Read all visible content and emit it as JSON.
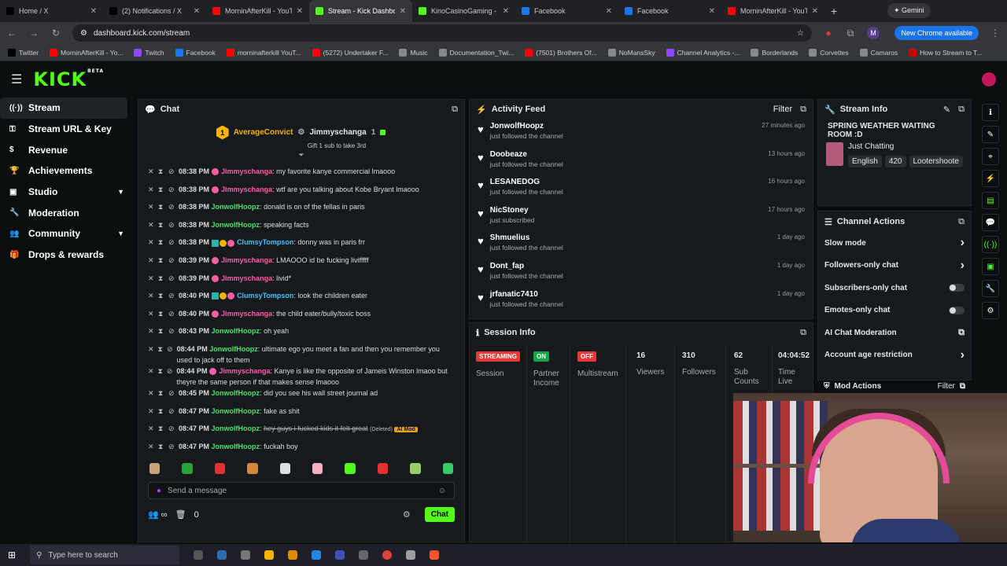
{
  "browser": {
    "tabs": [
      {
        "label": "Home / X",
        "color": "#000000"
      },
      {
        "label": "(2) Notifications / X",
        "color": "#000000"
      },
      {
        "label": "MorninAfterKill - YouTu",
        "color": "#ff0000"
      },
      {
        "label": "Stream - Kick Dashboard",
        "color": "#53fc18"
      },
      {
        "label": "KinoCasinoGaming - W",
        "color": "#53fc18"
      },
      {
        "label": "Facebook",
        "color": "#1877f2"
      },
      {
        "label": "Facebook",
        "color": "#1877f2"
      },
      {
        "label": "MorninAfterKill - YouTu",
        "color": "#ff0000"
      }
    ],
    "gemini_label": "Gemini",
    "url": "dashboard.kick.com/stream",
    "new_chrome": "New Chrome available",
    "profile_initial": "M",
    "bookmarks": [
      "Twitter",
      "MorninAfterKill - Yo...",
      "Twitch",
      "Facebook",
      "morninafterkill YouT...",
      "(5272) Undertaker F...",
      "Music",
      "Documentation_Twi...",
      "(7501) Brothers Of...",
      "NoMansSky",
      "Channel Analytics -...",
      "Borderlands",
      "Corvettes",
      "Camaros",
      "How to Stream to T..."
    ]
  },
  "kick": {
    "logo": "KICK",
    "beta": "BETA"
  },
  "sidebar": {
    "items": [
      {
        "label": "Stream",
        "icon": "stream-icon"
      },
      {
        "label": "Stream URL & Key",
        "icon": "key-icon"
      },
      {
        "label": "Revenue",
        "icon": "dollar-icon"
      },
      {
        "label": "Achievements",
        "icon": "trophy-icon"
      },
      {
        "label": "Studio",
        "icon": "studio-icon"
      },
      {
        "label": "Moderation",
        "icon": "wrench-icon"
      },
      {
        "label": "Community",
        "icon": "people-icon"
      },
      {
        "label": "Drops & rewards",
        "icon": "gift-icon"
      }
    ]
  },
  "chat": {
    "title": "Chat",
    "pinned": {
      "gifter": "AverageConvict",
      "gifter_count": "1",
      "recipient": "Jimmyschanga",
      "recipient_count": "1",
      "note": "Gift 1 sub to take 3rd"
    },
    "messages": [
      {
        "time": "08:38 PM",
        "user": "Jimmyschanga",
        "color": "pink",
        "text": "my favorite kanye commercial lmaooo"
      },
      {
        "time": "08:38 PM",
        "user": "Jimmyschanga",
        "color": "pink",
        "text": "wtf are you talking about Kobe Bryant lmaooo"
      },
      {
        "time": "08:38 PM",
        "user": "JonwolfHoopz",
        "color": "green",
        "text": "donald is on of the fellas in paris"
      },
      {
        "time": "08:38 PM",
        "user": "JonwolfHoopz",
        "color": "green",
        "text": "speaking facts"
      },
      {
        "time": "08:38 PM",
        "user": "ClumsyTompson",
        "color": "blue",
        "text": "donny was in paris frr"
      },
      {
        "time": "08:39 PM",
        "user": "Jimmyschanga",
        "color": "pink",
        "text": "LMAOOO id be fucking livifffff"
      },
      {
        "time": "08:39 PM",
        "user": "Jimmyschanga",
        "color": "pink",
        "text": "livid*"
      },
      {
        "time": "08:40 PM",
        "user": "ClumsyTompson",
        "color": "blue",
        "text": "look the children eater"
      },
      {
        "time": "08:40 PM",
        "user": "Jimmyschanga",
        "color": "pink",
        "text": "the child eater/bully/toxic boss"
      },
      {
        "time": "08:43 PM",
        "user": "JonwolfHoopz",
        "color": "green",
        "text": "oh yeah"
      },
      {
        "time": "08:44 PM",
        "user": "JonwolfHoopz",
        "color": "green",
        "text": "ultimate ego you meet a fan and then you remember you used to jack off to them"
      },
      {
        "time": "08:44 PM",
        "user": "Jimmyschanga",
        "color": "pink",
        "text": "Kanye is like the opposite of Jameis Winston lmaoo but theyre the same person if that makes sense lmaooo"
      },
      {
        "time": "08:45 PM",
        "user": "JonwolfHoopz",
        "color": "green",
        "text": "did you see his wall street journal ad"
      },
      {
        "time": "08:47 PM",
        "user": "JonwolfHoopz",
        "color": "green",
        "text": "fake as shit"
      },
      {
        "time": "08:47 PM",
        "user": "JonwolfHoopz",
        "color": "green",
        "text": "hey guys i fucked kids it felt great",
        "deleted": "(Deleted)",
        "ai": "AI Mod"
      },
      {
        "time": "08:47 PM",
        "user": "JonwolfHoopz",
        "color": "green",
        "text": "fuckah boy"
      }
    ],
    "input_placeholder": "Send a message",
    "footer_count": "0",
    "send_label": "Chat"
  },
  "activity": {
    "title": "Activity Feed",
    "filter": "Filter",
    "items": [
      {
        "name": "JonwolfHoopz",
        "action": "just followed the channel",
        "ago": "27 minutes ago"
      },
      {
        "name": "Doobeaze",
        "action": "just followed the channel",
        "ago": "13 hours ago"
      },
      {
        "name": "LESANEDOG",
        "action": "just followed the channel",
        "ago": "16 hours ago"
      },
      {
        "name": "NicStoney",
        "action": "just subscribed",
        "ago": "17 hours ago"
      },
      {
        "name": "Shmuelius",
        "action": "just followed the channel",
        "ago": "1 day ago"
      },
      {
        "name": "Dont_fap",
        "action": "just followed the channel",
        "ago": "1 day ago"
      },
      {
        "name": "jrfanatic7410",
        "action": "just followed the channel",
        "ago": "1 day ago"
      }
    ]
  },
  "session": {
    "title": "Session Info",
    "streaming": "STREAMING",
    "session_label": "Session",
    "partner_on": "ON",
    "partner_label": "Partner Income",
    "multi_off": "OFF",
    "multi_label": "Multistream",
    "viewers": "16",
    "viewers_label": "Viewers",
    "followers": "310",
    "followers_label": "Followers",
    "subs": "62",
    "subs_label": "Sub Counts",
    "time": "04:04:52",
    "time_label": "Time Live"
  },
  "stream_info": {
    "title": "Stream Info",
    "stream_title": "SPRING WEATHER WAITING ROOM :D",
    "category": "Just Chatting",
    "tags": [
      "English",
      "420",
      "Lootershoote"
    ]
  },
  "channel_actions": {
    "title": "Channel Actions",
    "items": [
      "Slow mode",
      "Followers-only chat",
      "Subscribers-only chat",
      "Emotes-only chat",
      "AI Chat Moderation",
      "Account age restriction"
    ]
  },
  "mod_actions": {
    "title": "Mod Actions",
    "filter": "Filter"
  },
  "taskbar": {
    "search": "Type here to search"
  },
  "colors": {
    "accent": "#53fc18",
    "streaming": "#e53935",
    "on": "#16a34a"
  }
}
